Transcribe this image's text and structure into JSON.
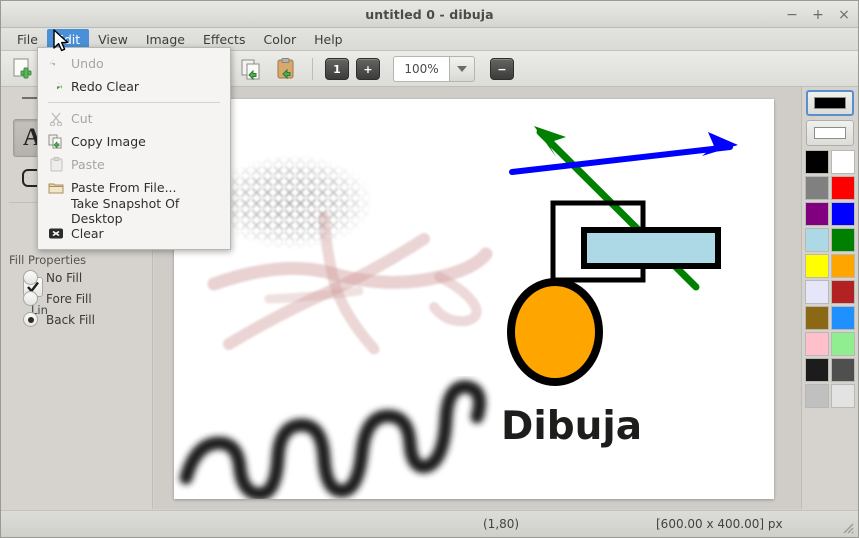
{
  "window": {
    "title": "untitled 0 - dibuja",
    "buttons": {
      "minimize": "−",
      "maximize": "+",
      "close": "×"
    }
  },
  "menubar": {
    "items": [
      {
        "label": "File",
        "active": false
      },
      {
        "label": "Edit",
        "active": true
      },
      {
        "label": "View",
        "active": false
      },
      {
        "label": "Image",
        "active": false
      },
      {
        "label": "Effects",
        "active": false
      },
      {
        "label": "Color",
        "active": false
      },
      {
        "label": "Help",
        "active": false
      }
    ]
  },
  "edit_menu": {
    "items": [
      {
        "label": "Undo",
        "icon": "undo-icon",
        "disabled": true
      },
      {
        "label": "Redo Clear",
        "icon": "redo-icon",
        "disabled": false
      },
      {
        "separator": true
      },
      {
        "label": "Cut",
        "icon": "scissors-icon",
        "disabled": true
      },
      {
        "label": "Copy Image",
        "icon": "copy-icon",
        "disabled": false
      },
      {
        "label": "Paste",
        "icon": "paste-icon",
        "disabled": true
      },
      {
        "label": "Paste From File...",
        "icon": "folder-icon",
        "disabled": false
      },
      {
        "label": "Take Snapshot Of Desktop",
        "icon": "",
        "disabled": false
      },
      {
        "label": "Clear",
        "icon": "clear-icon",
        "disabled": false
      }
    ]
  },
  "toolbar": {
    "new_image_icon": "new-image-icon",
    "copy_icon": "copy-image-icon",
    "paste_file_icon": "paste-from-file-icon",
    "layer_count": "1",
    "add_label": "+",
    "zoom_value": "100%",
    "zoom_dropdown_icon": "chevron-down-icon",
    "zoom_out_label": "−"
  },
  "tools": {
    "line_icon": "line-tool-icon",
    "text_icon": "A",
    "shape_icon": "rounded-rect-tool-icon",
    "antialias_checked": true,
    "line_label": "Lin",
    "fill_properties_label": "Fill Properties",
    "fill_options": [
      {
        "label": "No Fill",
        "selected": false
      },
      {
        "label": "Fore Fill",
        "selected": false
      },
      {
        "label": "Back Fill",
        "selected": true
      }
    ]
  },
  "palette": {
    "primary_color": "#000000",
    "secondary_color": "#ffffff",
    "swatches": [
      "#000000",
      "#ffffff",
      "#808080",
      "#ff0000",
      "#800080",
      "#0000ff",
      "#add8e6",
      "#008000",
      "#ffff00",
      "#ffa500",
      "#e6e6fa",
      "#b22222",
      "#8b6914",
      "#1e90ff",
      "#ffc0cb",
      "#90ee90",
      "#1c1c1c",
      "#4f4f4f",
      "#c0c0c0",
      "#e3e3e3"
    ]
  },
  "canvas": {
    "text_object": "Dibuja",
    "rect_fill": "#add8e6",
    "ellipse_fill": "#ffa500",
    "arrow_green": "#008000",
    "arrow_blue": "#0000ff",
    "spray_color": "#c08080",
    "stroke_color": "#000000"
  },
  "statusbar": {
    "coordinates": "(1,80)",
    "image_size": "[600.00 x 400.00] px"
  }
}
